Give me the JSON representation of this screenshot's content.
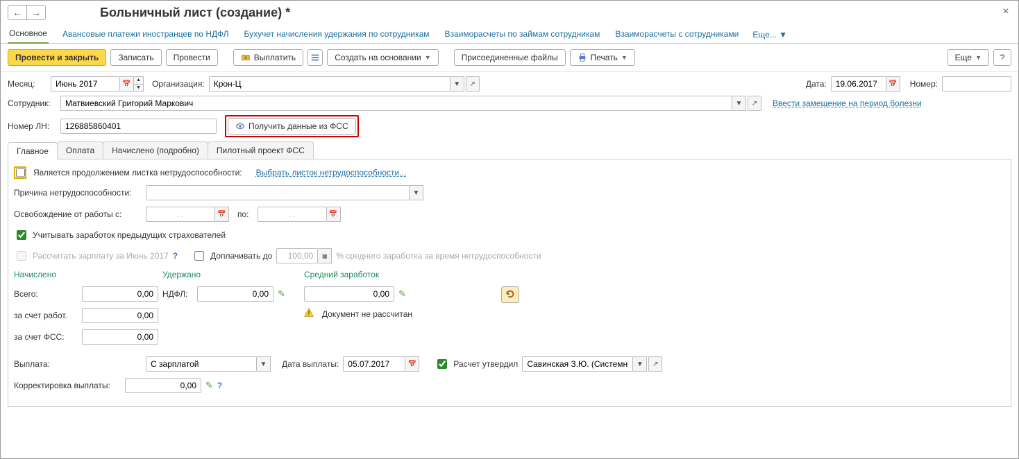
{
  "title": "Больничный лист (создание) *",
  "topTabs": {
    "main": "Основное",
    "advances": "Авансовые платежи иностранцев по НДФЛ",
    "accounting": "Бухучет начисления удержания по сотрудникам",
    "loans": "Взаиморасчеты по займам сотрудникам",
    "settlements": "Взаиморасчеты с сотрудниками",
    "more": "Еще..."
  },
  "toolbar": {
    "postClose": "Провести и закрыть",
    "write": "Записать",
    "post": "Провести",
    "pay": "Выплатить",
    "createBased": "Создать на основании",
    "attached": "Присоединенные файлы",
    "print": "Печать",
    "more": "Еще"
  },
  "header": {
    "month_label": "Месяц:",
    "month_value": "Июнь 2017",
    "org_label": "Организация:",
    "org_value": "Крон-Ц",
    "date_label": "Дата:",
    "date_value": "19.06.2017",
    "number_label": "Номер:",
    "number_value": "",
    "employee_label": "Сотрудник:",
    "employee_value": "Матвиевский Григорий Маркович",
    "substitution_link": "Ввести замещение на период болезни",
    "ln_label": "Номер ЛН:",
    "ln_value": "126885860401",
    "fss_button": "Получить данные из ФСС"
  },
  "tabs": {
    "main": "Главное",
    "payment": "Оплата",
    "accruedDetail": "Начислено (подробно)",
    "pilot": "Пилотный проект ФСС"
  },
  "main": {
    "continuation_label": "Является продолжением листка нетрудоспособности:",
    "choose_sheet": "Выбрать листок нетрудоспособности...",
    "reason_label": "Причина нетрудоспособности:",
    "release_label": "Освобождение от работы с:",
    "to_label": "по:",
    "empty_date": ". .",
    "prev_employers": "Учитывать заработок предыдущих страхователей",
    "calc_salary": "Рассчитать зарплату за Июнь 2017",
    "pay_up_to": "Доплачивать до",
    "pay_up_value": "100,00",
    "pay_up_suffix": "% среднего заработка за время нетрудоспособности",
    "accrued_head": "Начислено",
    "withheld_head": "Удержано",
    "avg_head": "Средний заработок",
    "total_label": "Всего:",
    "employer_label": "за счет работ.",
    "fss_label": "за счет ФСС:",
    "ndfl_label": "НДФЛ:",
    "zero": "0,00",
    "not_calc": "Документ не рассчитан",
    "payout_label": "Выплата:",
    "payout_value": "С зарплатой",
    "payout_date_label": "Дата выплаты:",
    "payout_date_value": "05.07.2017",
    "approved_label": "Расчет утвердил",
    "approved_value": "Савинская З.Ю. (Системны",
    "correction_label": "Корректировка выплаты:",
    "correction_value": "0,00"
  }
}
